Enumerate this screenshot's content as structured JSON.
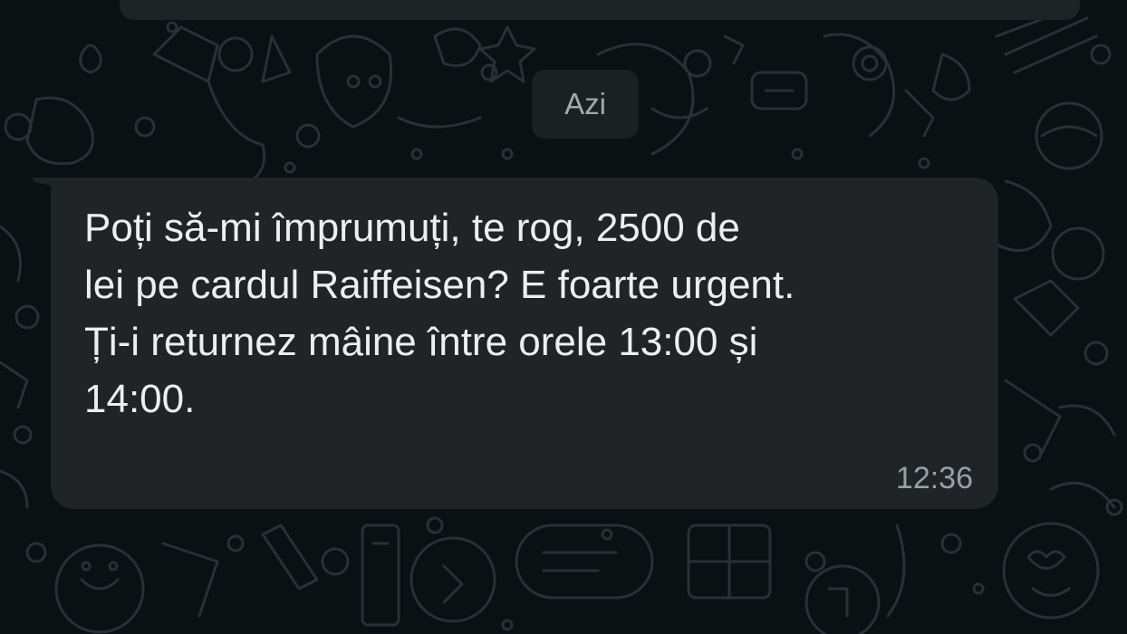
{
  "chat": {
    "date_separator": "Azi",
    "messages": [
      {
        "direction": "incoming",
        "text": "Poți să-mi împrumuți, te rog, 2500 de\nlei pe cardul Raiffeisen? E foarte urgent.\nȚi-i returnez mâine între orele 13:00 și\n14:00.",
        "time": "12:36"
      }
    ]
  },
  "theme": {
    "wallpaper_color": "#0b1013",
    "doodle_color": "#2a3034",
    "bubble_incoming_color": "#202427",
    "text_color": "#eceef0",
    "meta_text_color": "#9a9fa3"
  }
}
